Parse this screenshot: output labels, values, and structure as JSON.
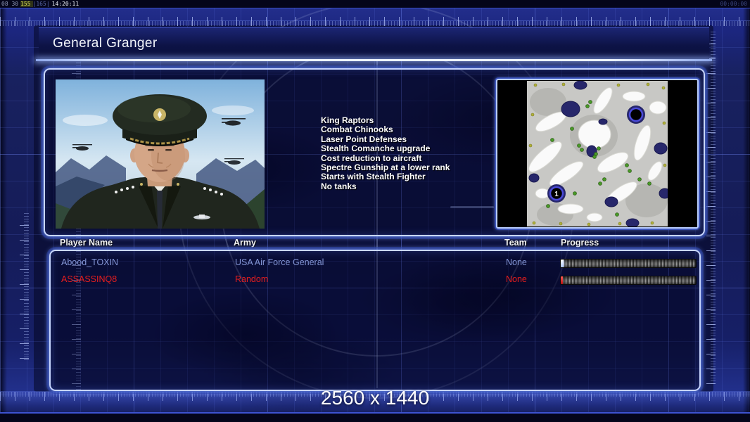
{
  "status_bar": {
    "fps_text": "08 30",
    "counter_highlight": "155",
    "counter_dim": "|165|",
    "clock": "14:20:11",
    "timer": "00:00:00"
  },
  "header": {
    "title": "General Granger"
  },
  "general": {
    "abilities": [
      "King Raptors",
      "Combat Chinooks",
      "Laser Point Defenses",
      "Stealth Comanche upgrade",
      "Cost reduction to aircraft",
      "Spectre Gunship at a lower rank",
      "Starts with Stealth Fighter",
      "No tanks"
    ]
  },
  "minimap": {
    "spawn_marker_label": "1"
  },
  "players": {
    "columns": [
      "Player Name",
      "Army",
      "Team",
      "Progress"
    ],
    "rows": [
      {
        "name": "Abood_TOXIN",
        "army": "USA Air Force General",
        "team": "None",
        "progress_percent": 2,
        "color": "#8496d6"
      },
      {
        "name": "ASSASSINQ8",
        "army": "Random",
        "team": "None",
        "progress_percent": 1.5,
        "color": "#e81e1e"
      }
    ]
  },
  "footer": {
    "resolution": "2560 x 1440"
  },
  "colors": {
    "background": "#151c58",
    "panel_border": "#c9d7ff",
    "accent_glow": "#7fa0ff",
    "player_blue": "#8496d6",
    "player_red": "#e81e1e",
    "grid_line": "#6076e6"
  }
}
